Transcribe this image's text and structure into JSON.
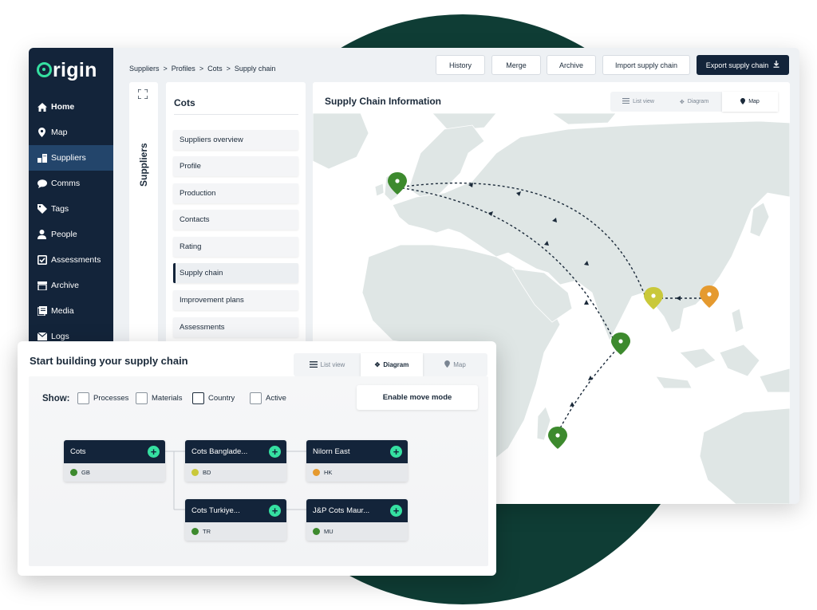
{
  "app": {
    "logo": "rigin",
    "breadcrumb": [
      "Suppliers",
      "Profiles",
      "Cots",
      "Supply chain"
    ],
    "breadcrumb_sep": ">",
    "toolbar": {
      "history": "History",
      "merge": "Merge",
      "archive": "Archive",
      "import": "Import supply chain",
      "export": "Export supply chain"
    }
  },
  "sidebar": {
    "items": [
      {
        "label": "Home",
        "icon": "home-icon"
      },
      {
        "label": "Map",
        "icon": "map-pin-icon"
      },
      {
        "label": "Suppliers",
        "icon": "suppliers-icon"
      },
      {
        "label": "Comms",
        "icon": "chat-bubble-icon"
      },
      {
        "label": "Tags",
        "icon": "tag-icon"
      },
      {
        "label": "People",
        "icon": "person-icon"
      },
      {
        "label": "Assessments",
        "icon": "checkbox-icon"
      },
      {
        "label": "Archive",
        "icon": "archive-box-icon"
      },
      {
        "label": "Media",
        "icon": "media-icon"
      },
      {
        "label": "Logs",
        "icon": "mail-icon"
      }
    ],
    "active": "Suppliers"
  },
  "collapsed_panel": {
    "label": "Suppliers"
  },
  "subnav": {
    "title": "Cots",
    "items": [
      "Suppliers overview",
      "Profile",
      "Production",
      "Contacts",
      "Rating",
      "Supply chain",
      "Improvement plans",
      "Assessments"
    ],
    "active": "Supply chain"
  },
  "map_card": {
    "title": "Supply Chain Information",
    "views": {
      "list": "List view",
      "diagram": "Diagram",
      "map": "Map"
    },
    "active_view": "Map",
    "pin_colors": {
      "green": "#3d8a2e",
      "yellow": "#c9c83a",
      "orange": "#e59a2f"
    }
  },
  "diagram": {
    "title": "Start building your supply chain",
    "views": {
      "list": "List view",
      "diagram": "Diagram",
      "map": "Map"
    },
    "active_view": "Diagram",
    "show_label": "Show:",
    "filters": [
      "Processes",
      "Materials",
      "Country",
      "Active"
    ],
    "move_button": "Enable move mode",
    "nodes": [
      {
        "name": "Cots",
        "code": "GB",
        "color": "#3d8a2e"
      },
      {
        "name": "Cots Banglade...",
        "code": "BD",
        "color": "#c9c83a"
      },
      {
        "name": "Nilorn East",
        "code": "HK",
        "color": "#e59a2f"
      },
      {
        "name": "Cots Turkiye...",
        "code": "TR",
        "color": "#3d8a2e"
      },
      {
        "name": "J&P Cots Maur...",
        "code": "MU",
        "color": "#3d8a2e"
      }
    ]
  }
}
